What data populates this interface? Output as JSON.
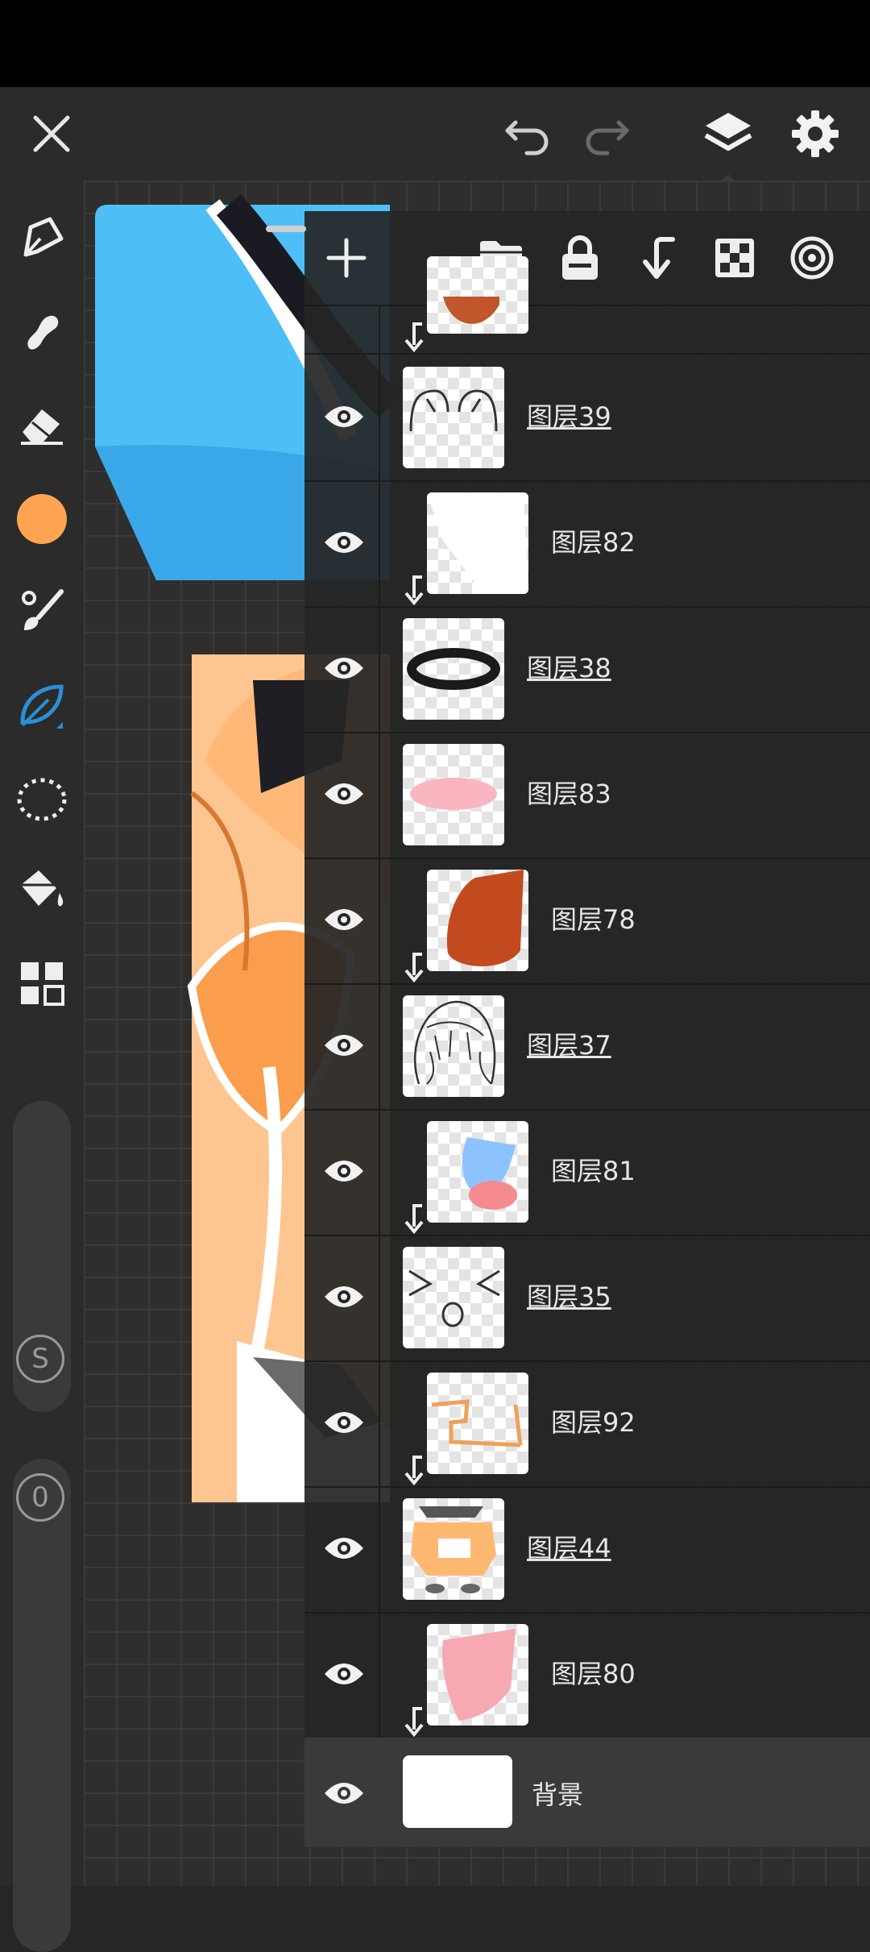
{
  "topbar": {
    "close_icon": "close-icon",
    "undo_icon": "undo-icon",
    "redo_icon": "redo-icon",
    "layers_icon": "layers-icon",
    "settings_icon": "settings-icon"
  },
  "tools": [
    {
      "name": "pen-icon"
    },
    {
      "name": "smudge-icon"
    },
    {
      "name": "eraser-icon"
    },
    {
      "name": "color-swatch",
      "color": "#FFA552"
    },
    {
      "name": "brush-icon"
    },
    {
      "name": "leaf-brush-icon",
      "active": true
    },
    {
      "name": "lasso-icon"
    },
    {
      "name": "fill-bucket-icon"
    },
    {
      "name": "grid-icon"
    }
  ],
  "sliders": {
    "size_label": "S",
    "opacity_label": "0"
  },
  "panel": {
    "toolbar_icons": [
      "add-layer-icon",
      "folder-icon",
      "lock-icon",
      "merge-down-icon",
      "transparency-icon",
      "blend-mode-icon"
    ]
  },
  "layers": [
    {
      "name": "图层39",
      "clipped": false,
      "underlined": true
    },
    {
      "name": "图层82",
      "clipped": true,
      "underlined": false
    },
    {
      "name": "图层38",
      "clipped": false,
      "underlined": true
    },
    {
      "name": "图层83",
      "clipped": false,
      "underlined": false
    },
    {
      "name": "图层78",
      "clipped": true,
      "underlined": false
    },
    {
      "name": "图层37",
      "clipped": false,
      "underlined": true
    },
    {
      "name": "图层81",
      "clipped": true,
      "underlined": false
    },
    {
      "name": "图层35",
      "clipped": false,
      "underlined": true
    },
    {
      "name": "图层92",
      "clipped": true,
      "underlined": false
    },
    {
      "name": "图层44",
      "clipped": false,
      "underlined": true
    },
    {
      "name": "图层80",
      "clipped": true,
      "underlined": false
    }
  ],
  "background_layer": {
    "name": "背景"
  },
  "colors": {
    "accent": "#2a8fd8",
    "swatch": "#FFA552",
    "panel_bg": "#262626"
  }
}
